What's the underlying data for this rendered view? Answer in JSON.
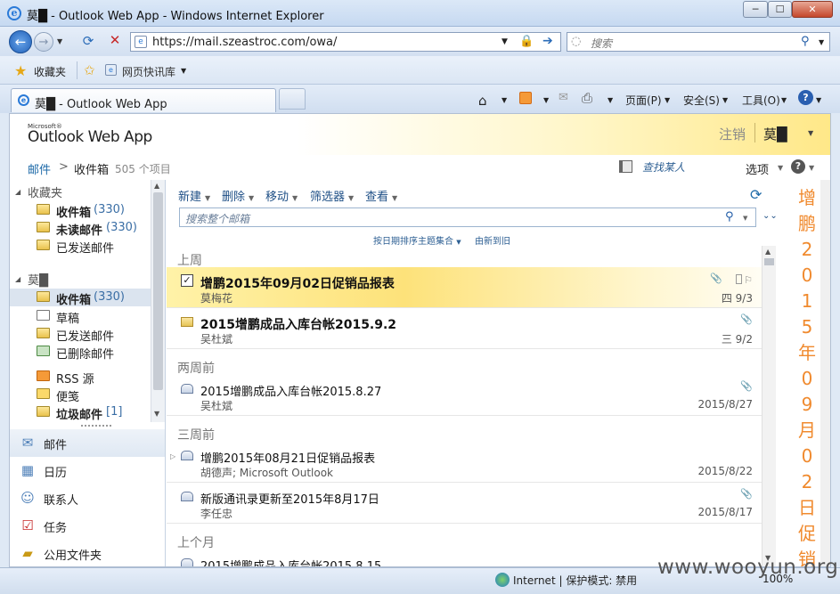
{
  "window": {
    "title": "莫█ - Outlook Web App - Windows Internet Explorer",
    "min": "─",
    "max": "☐",
    "close": "✕"
  },
  "address": {
    "url": "https://mail.szeastroc.com/owa/",
    "search_placeholder": "搜索"
  },
  "favorites": {
    "label": "收藏夹",
    "library": "网页快讯库"
  },
  "tab": {
    "title": "莫█ - Outlook Web App"
  },
  "commandbar": {
    "page": "页面(P)",
    "safety": "安全(S)",
    "tools": "工具(O)"
  },
  "owa": {
    "logo_small": "Microsoft®",
    "logo": "Outlook Web App",
    "signout": "注销",
    "user": "莫█",
    "breadcrumb": {
      "mail": "邮件",
      "sep": ">",
      "folder": "收件箱",
      "count": "505 个项目"
    },
    "find_people": "查找某人",
    "options": "选项",
    "help": "?"
  },
  "nav": {
    "favorites_header": "收藏夹",
    "favorites": [
      {
        "label": "收件箱",
        "count": "(330)"
      },
      {
        "label": "未读邮件",
        "count": "(330)"
      },
      {
        "label": "已发送邮件",
        "count": ""
      }
    ],
    "mailbox_header": "莫█",
    "folders": [
      {
        "label": "收件箱",
        "count": "(330)"
      },
      {
        "label": "草稿",
        "count": ""
      },
      {
        "label": "已发送邮件",
        "count": ""
      },
      {
        "label": "已删除邮件",
        "count": ""
      },
      {
        "label": "RSS 源",
        "count": ""
      },
      {
        "label": "便笺",
        "count": ""
      },
      {
        "label": "垃圾邮件",
        "count": "[1]"
      }
    ],
    "modules": [
      "邮件",
      "日历",
      "联系人",
      "任务",
      "公用文件夹"
    ]
  },
  "toolbar": {
    "new": "新建",
    "delete": "删除",
    "move": "移动",
    "filter": "筛选器",
    "view": "查看"
  },
  "list": {
    "search_placeholder": "搜索整个邮箱",
    "sort_by": "按日期排序主题集合",
    "sort_order": "由新到旧",
    "sections": [
      "上周",
      "两周前",
      "三周前",
      "上个月"
    ],
    "messages": [
      {
        "subject": "增鹏2015年09月02日促销品报表",
        "from": "莫梅花",
        "date": "四 9/3"
      },
      {
        "subject": "2015增鹏成品入库台帐2015.9.2",
        "from": "吴杜斌",
        "date": "三 9/2"
      },
      {
        "subject": "2015增鹏成品入库台帐2015.8.27",
        "from": "吴杜斌",
        "date": "2015/8/27"
      },
      {
        "subject": "增鹏2015年08月21日促销品报表",
        "from": "胡德声; Microsoft Outlook",
        "date": "2015/8/22"
      },
      {
        "subject": "新版通讯录更新至2015年8月17日",
        "from": "李任忠",
        "date": "2015/8/17"
      },
      {
        "subject": "2015增鹏成品入库台帐2015.8.15",
        "from": "",
        "date": ""
      }
    ]
  },
  "reading": {
    "title": "增鹏2015年09月02日促销"
  },
  "status": {
    "zone": "Internet | 保护模式: 禁用",
    "zoom": "100%",
    "watermark": "www.wooyun.org"
  }
}
